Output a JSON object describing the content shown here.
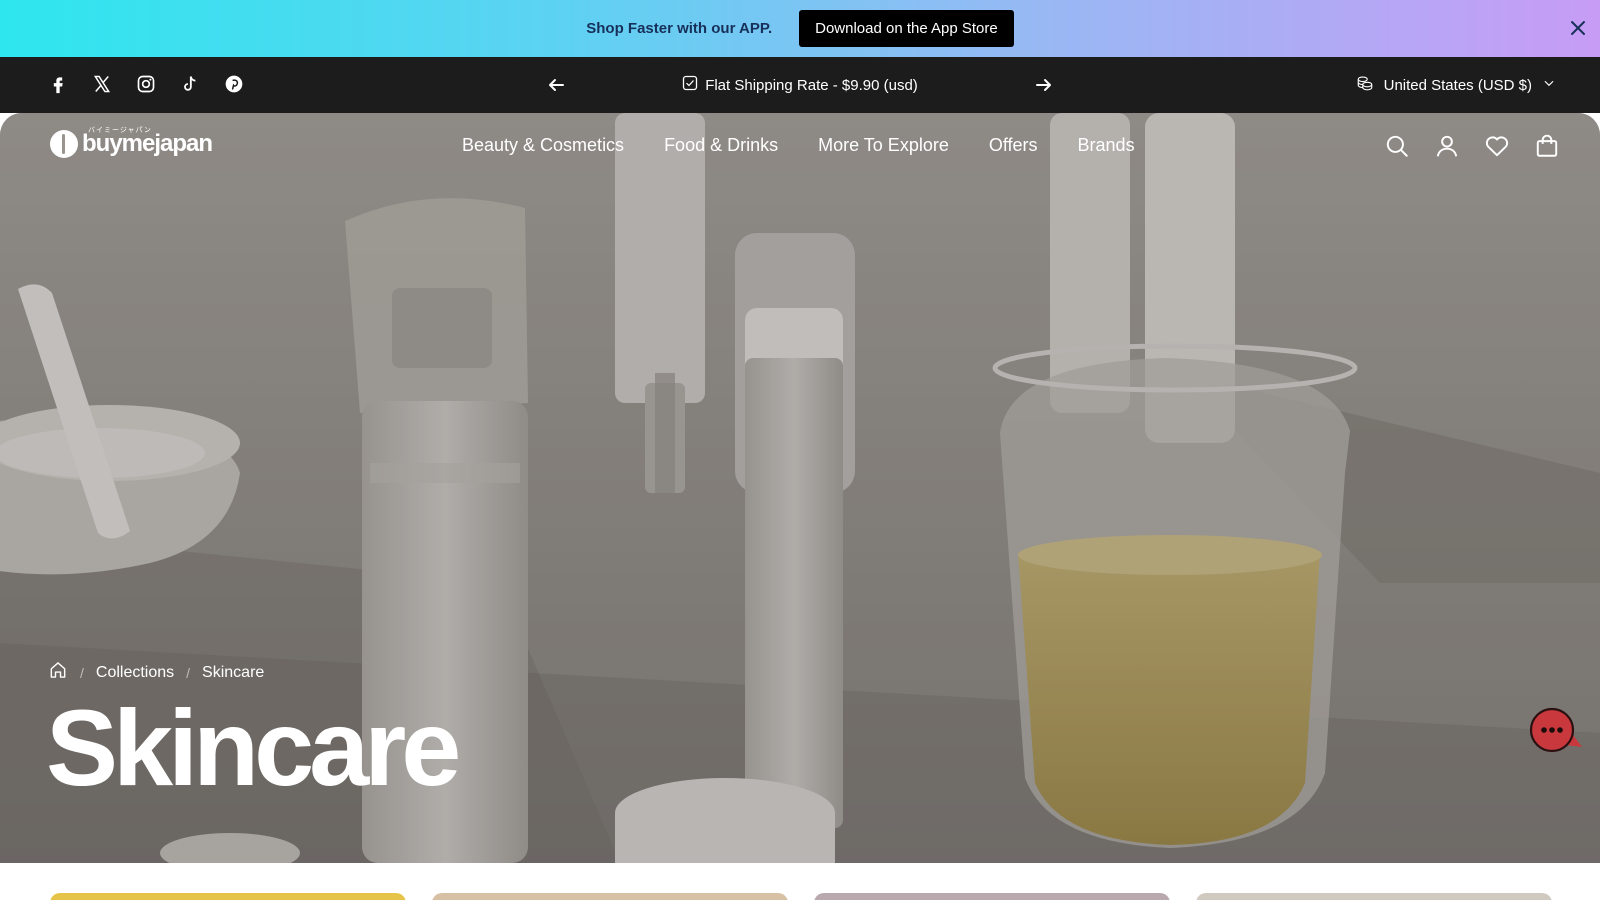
{
  "promo": {
    "text": "Shop Faster with our APP.",
    "button_label": "Download on the App Store"
  },
  "utility": {
    "socials": [
      "facebook-icon",
      "x-icon",
      "instagram-icon",
      "tiktok-icon",
      "pinterest-icon"
    ],
    "announcement": "Flat Shipping Rate - $9.90 (usd)",
    "locale": "United States (USD $)"
  },
  "header": {
    "logo_text": "buymejapan",
    "logo_small": "バイミージャパン",
    "nav": [
      "Beauty & Cosmetics",
      "Food & Drinks",
      "More To Explore",
      "Offers",
      "Brands"
    ],
    "icons": [
      "search-icon",
      "account-icon",
      "wishlist-icon",
      "cart-icon"
    ]
  },
  "breadcrumb": {
    "items": [
      "Collections",
      "Skincare"
    ]
  },
  "page": {
    "title": "Skincare"
  },
  "colors": {
    "promo_start": "#2ee6ee",
    "promo_end": "#c79cf5",
    "utility_bg": "#1c1c1c",
    "chat_bubble": "#c8383c"
  },
  "cards": {
    "colors": [
      "#e6c44a",
      "#d8c0a4",
      "#b9a8ae",
      "#cfc9bf"
    ]
  }
}
